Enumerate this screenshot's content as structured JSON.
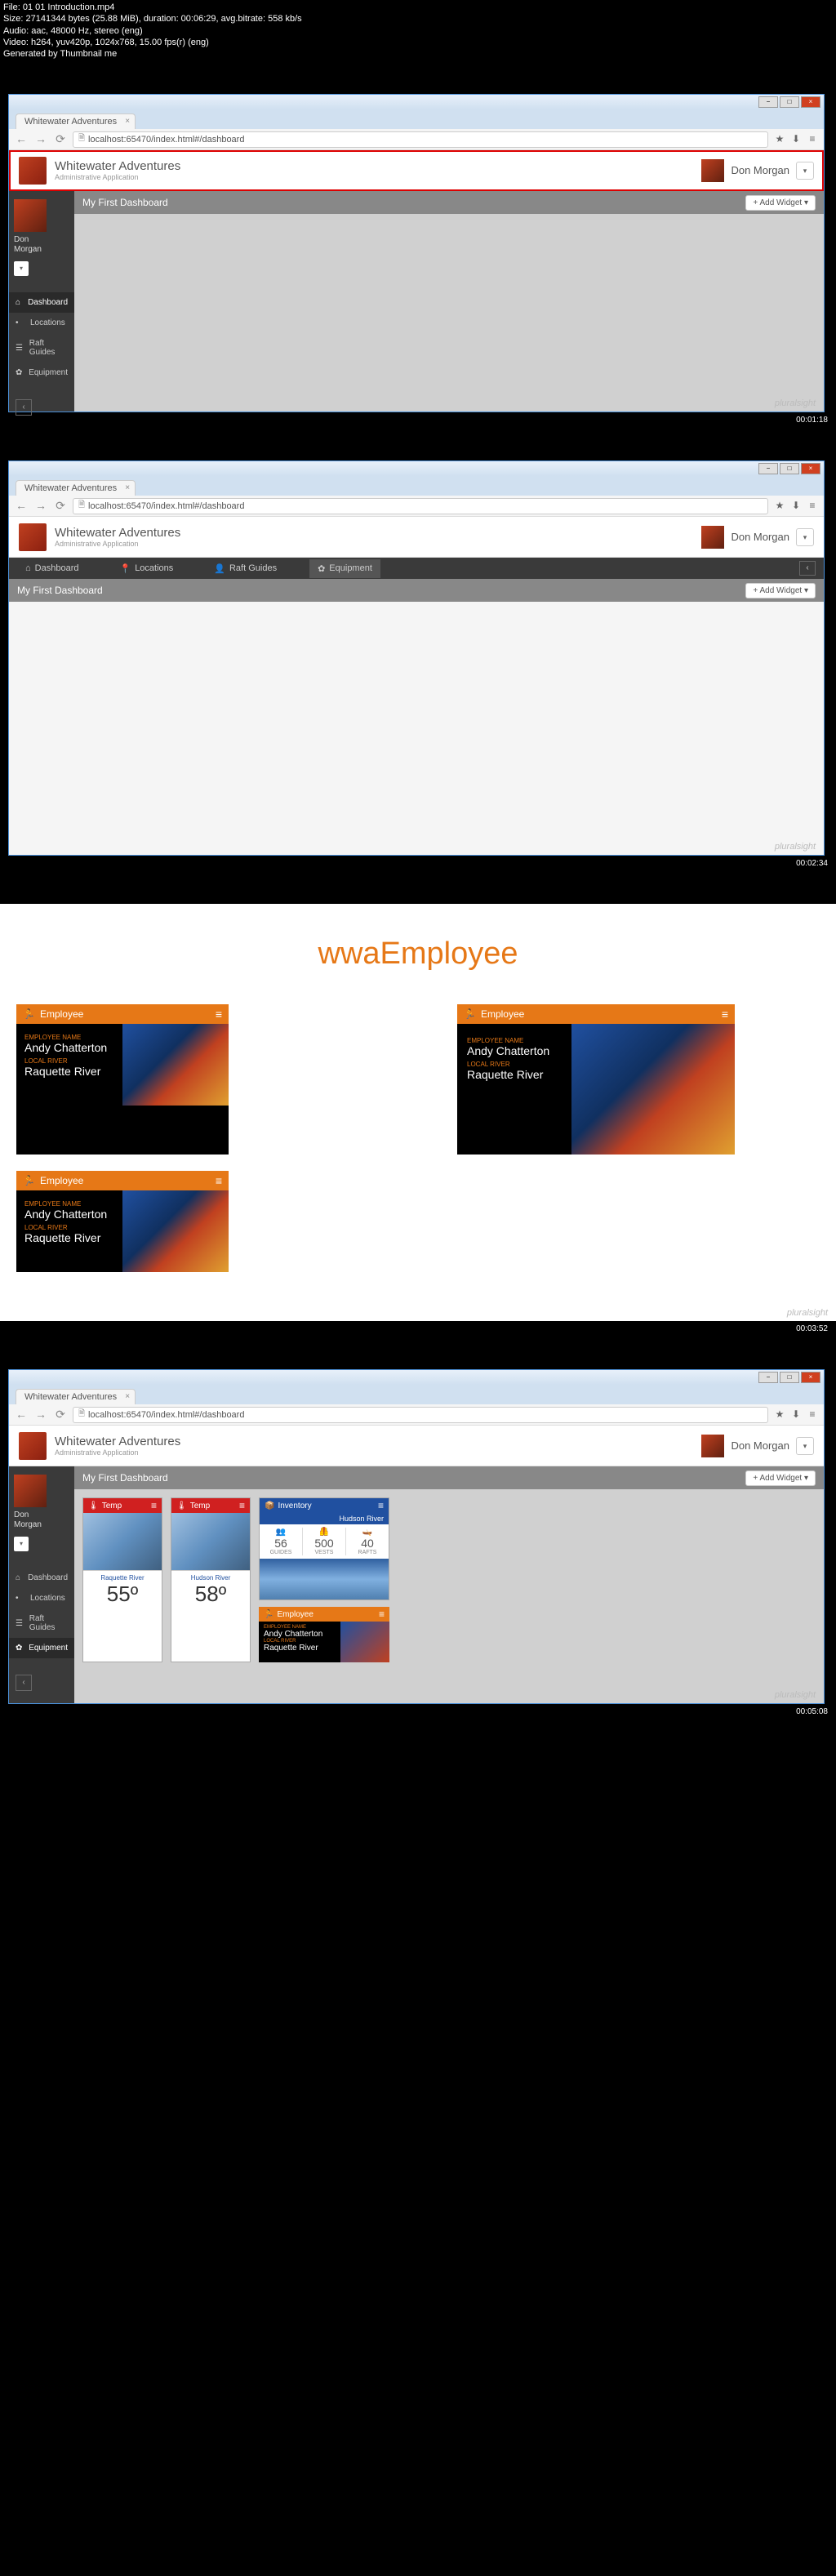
{
  "meta": {
    "file": "File: 01 01 Introduction.mp4",
    "size": "Size: 27141344 bytes (25.88 MiB), duration: 00:06:29, avg.bitrate: 558 kb/s",
    "audio": "Audio: aac, 48000 Hz, stereo (eng)",
    "video": "Video: h264, yuv420p, 1024x768, 15.00 fps(r) (eng)",
    "gen": "Generated by Thumbnail me"
  },
  "browser": {
    "tab_title": "Whitewater Adventures",
    "url": "localhost:65470/index.html#/dashboard"
  },
  "app": {
    "title": "Whitewater Adventures",
    "subtitle": "Administrative Application",
    "user": "Don Morgan"
  },
  "sidebar": {
    "user_first": "Don",
    "user_last": "Morgan",
    "items": [
      {
        "icon": "⌂",
        "label": "Dashboard"
      },
      {
        "icon": "•",
        "label": "Locations"
      },
      {
        "icon": "☰",
        "label": "Raft Guides"
      },
      {
        "icon": "✿",
        "label": "Equipment"
      }
    ]
  },
  "hnav": {
    "items": [
      {
        "icon": "⌂",
        "label": "Dashboard"
      },
      {
        "icon": "📍",
        "label": "Locations"
      },
      {
        "icon": "👤",
        "label": "Raft Guides"
      },
      {
        "icon": "✿",
        "label": "Equipment"
      }
    ]
  },
  "dashboard": {
    "title": "My First Dashboard",
    "add_widget": "+ Add Widget"
  },
  "timestamps": {
    "t1": "00:01:18",
    "t2": "00:02:34",
    "t3": "00:03:52",
    "t4": "00:05:08"
  },
  "watermark": "pluralsight",
  "slide3": {
    "title": "wwaEmployee",
    "emp_head": "Employee",
    "name_label": "EMPLOYEE NAME",
    "name": "Andy Chatterton",
    "river_label": "LOCAL RIVER",
    "river": "Raquette River"
  },
  "widgets": {
    "temp": "Temp",
    "inventory": "Inventory",
    "employee": "Employee",
    "loc1": "Raquette River",
    "deg1": "55º",
    "loc2": "Hudson River",
    "deg2": "58º",
    "inv_loc": "Hudson River",
    "guides_n": "56",
    "guides_l": "GUIDES",
    "vests_n": "500",
    "vests_l": "VESTS",
    "rafts_n": "40",
    "rafts_l": "RAFTS",
    "emp_name_label": "EMPLOYEE NAME",
    "emp_name": "Andy Chatterton",
    "emp_river_label": "LOCAL RIVER",
    "emp_river": "Raquette River"
  }
}
